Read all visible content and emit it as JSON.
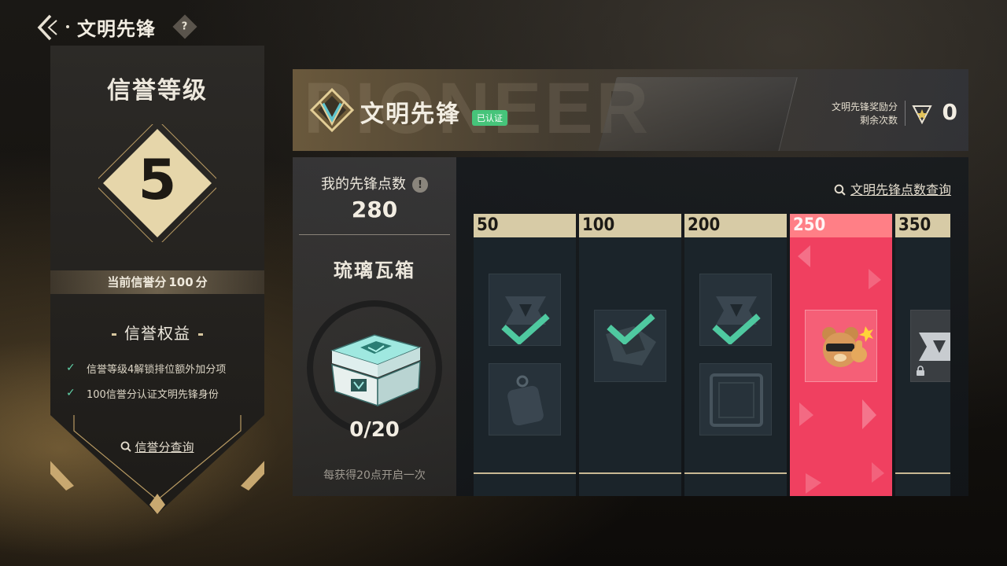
{
  "topbar": {
    "title": "文明先锋",
    "help": "?"
  },
  "left_panel": {
    "title": "信誉等级",
    "level": "5",
    "score_prefix": "当前信誉分",
    "score_value": "100",
    "score_suffix": "分",
    "benefits_title": "信誉权益",
    "benefits": [
      "信誉等级4解锁排位额外加分项",
      "100信誉分认证文明先锋身份"
    ],
    "query_label": "信誉分查询"
  },
  "header": {
    "bg_text": "PIONEER",
    "name": "文明先锋",
    "verified": "已认证",
    "reward_label_line1": "文明先锋奖励分",
    "reward_label_line2": "剩余次数",
    "reward_count": "0"
  },
  "points": {
    "label": "我的先锋点数",
    "info": "!",
    "value": "280",
    "box_name": "琉璃瓦箱",
    "progress": "0/20",
    "progress_fraction": 0,
    "hint": "每获得20点开启一次"
  },
  "track": {
    "query_label": "文明先锋点数查询",
    "tiers": [
      {
        "threshold": "50",
        "claimed": true,
        "items": 2,
        "active": false
      },
      {
        "threshold": "100",
        "claimed": true,
        "items": 1,
        "active": false
      },
      {
        "threshold": "200",
        "claimed": true,
        "items": 2,
        "active": false
      },
      {
        "threshold": "250",
        "claimed": false,
        "items": 1,
        "active": true
      },
      {
        "threshold": "350",
        "claimed": false,
        "items": 1,
        "active": false,
        "locked": true
      }
    ]
  },
  "colors": {
    "accent_gold": "#d7cba6",
    "active_pink": "#f04060",
    "check_green": "#4fc9a0",
    "verified_green": "#46c47a"
  }
}
